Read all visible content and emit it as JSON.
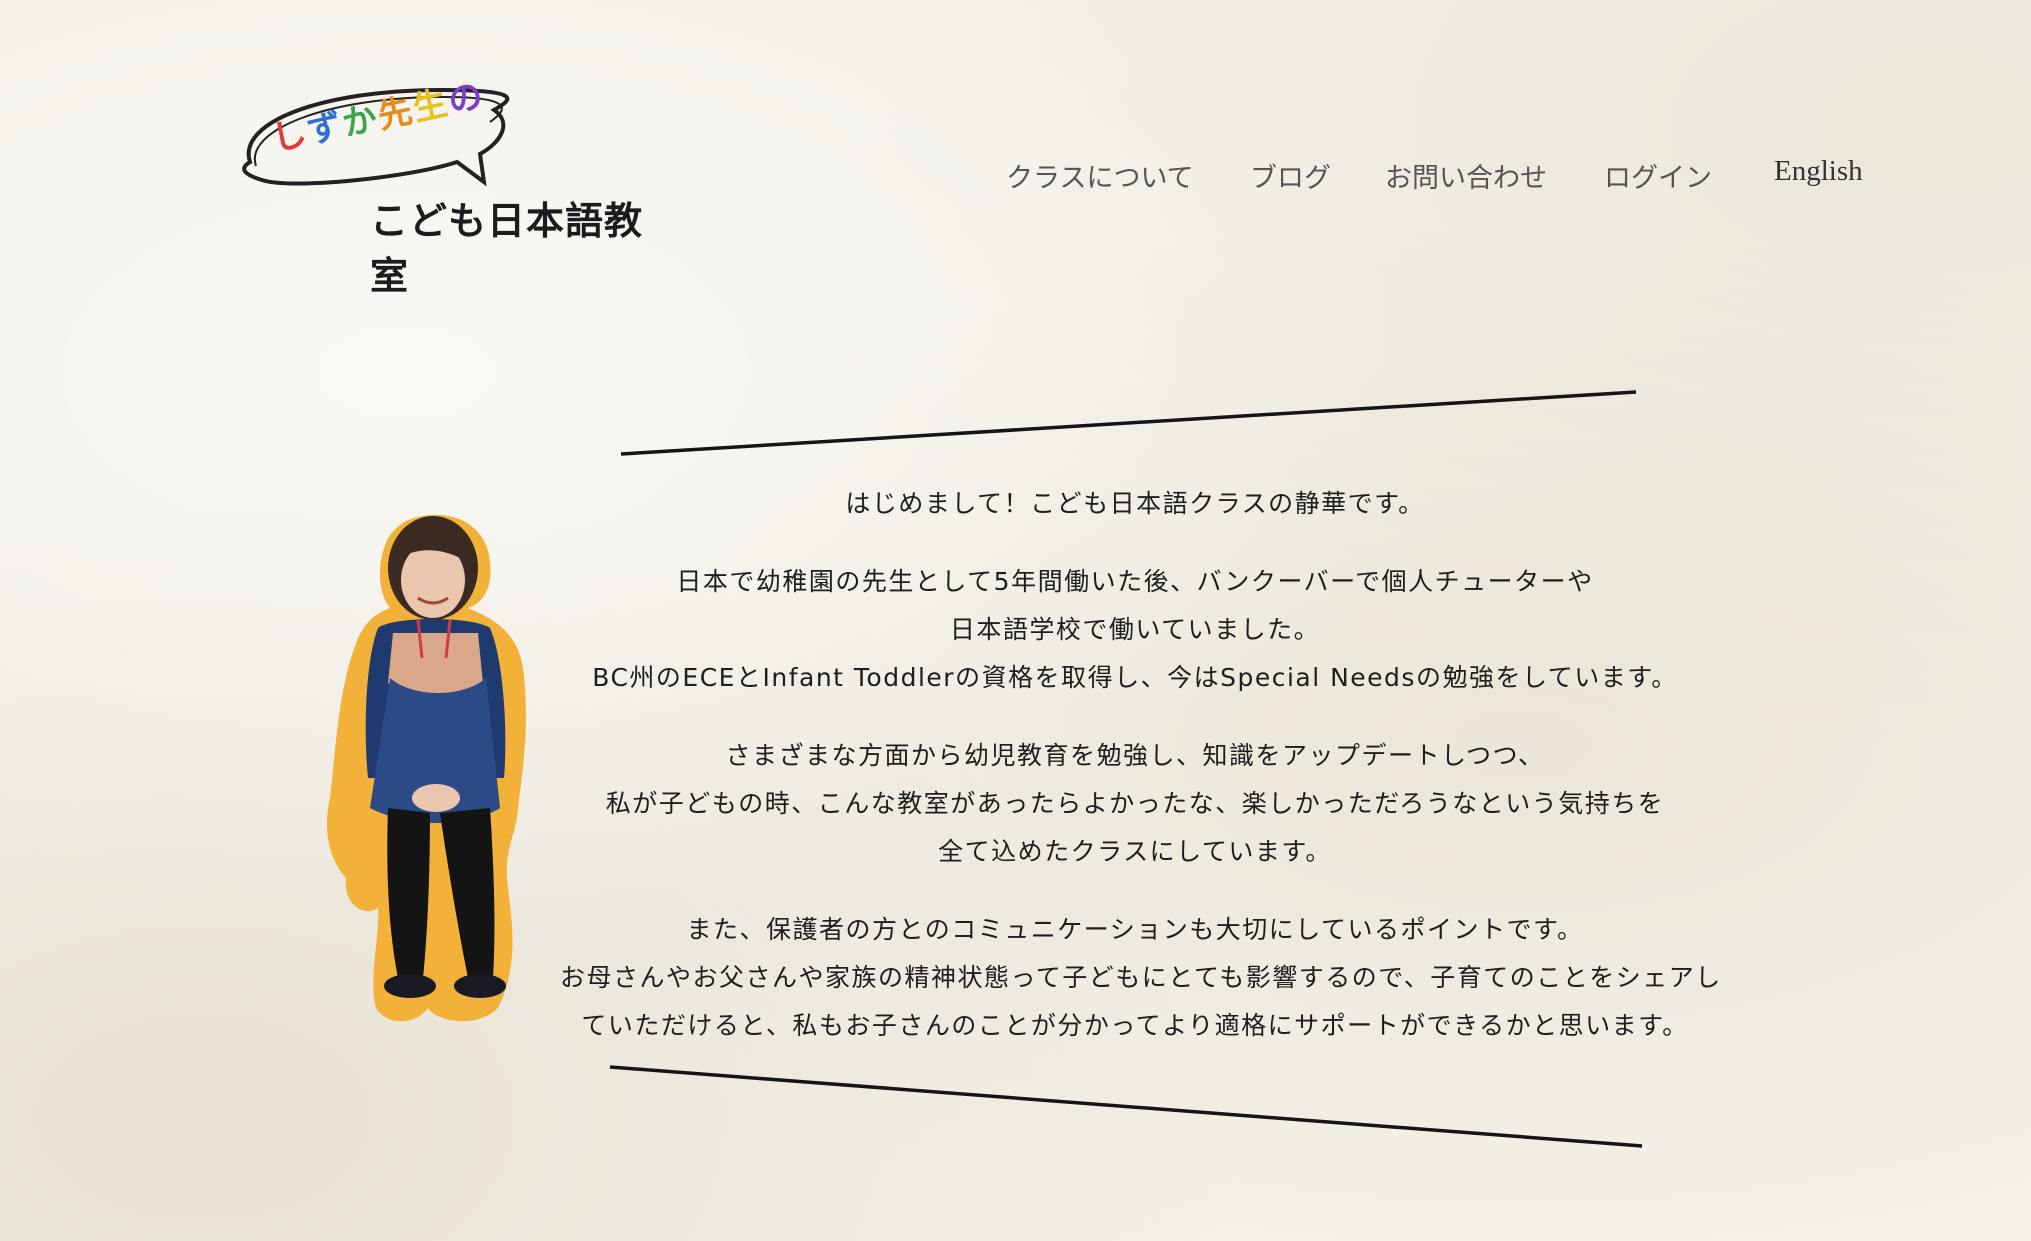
{
  "logo": {
    "bubble_chars": [
      "し",
      "ず",
      "か",
      "先",
      "生",
      "の"
    ],
    "bubble_colors": [
      "#e03a3a",
      "#2f6fd1",
      "#3ca44b",
      "#e88b1a",
      "#e6c21a",
      "#7a3fc2"
    ],
    "subtitle": "こども日本語教室"
  },
  "nav": {
    "items": [
      {
        "label": "クラスについて"
      },
      {
        "label": "ブログ"
      },
      {
        "label": "お問い合わせ"
      },
      {
        "label": "ログイン"
      },
      {
        "label": "English"
      }
    ]
  },
  "intro": {
    "paragraphs": [
      [
        "はじめまして！こども日本語クラスの静華です。"
      ],
      [
        "日本で幼稚園の先生として5年間働いた後、バンクーバーで個人チューターや",
        "日本語学校で働いていました。",
        "BC州のECEとInfant Toddlerの資格を取得し、今はSpecial Needsの勉強をしています。"
      ],
      [
        "さまざまな方面から幼児教育を勉強し、知識をアップデートしつつ、",
        "私が子どもの時、こんな教室があったらよかったな、楽しかっただろうなという気持ちを",
        "全て込めたクラスにしています。"
      ],
      [
        "また、保護者の方とのコミュニケーションも大切にしているポイントです。",
        "お母さんやお父さんや家族の精神状態って子どもにとても影響するので、子育てのことをシェアし",
        "ていただけると、私もお子さんのことが分かってより適格にサポートができるかと思います。"
      ]
    ]
  },
  "colors": {
    "photo_outline": "#f2b23a",
    "apron": "#2b4a86",
    "apron_trim": "#d9a88a"
  }
}
